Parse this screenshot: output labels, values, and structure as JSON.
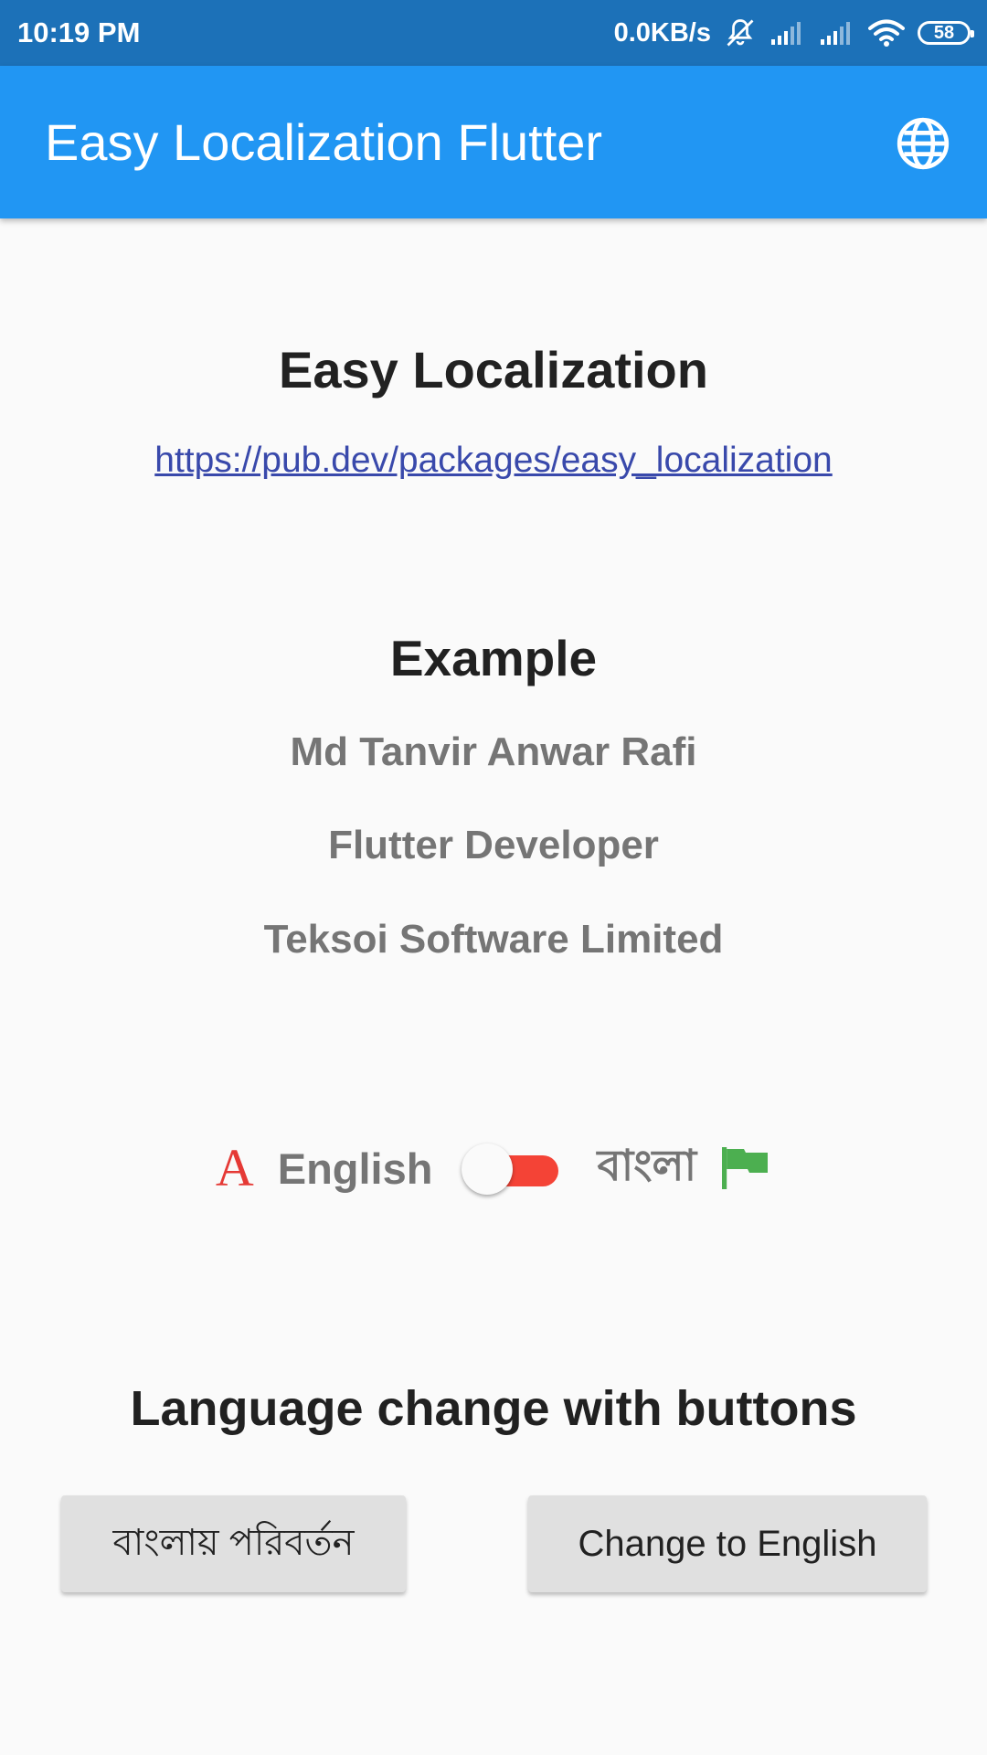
{
  "status_bar": {
    "time": "10:19 PM",
    "net_speed": "0.0KB/s",
    "battery_level": "58",
    "icons": [
      "muted-bell-icon",
      "signal-icon",
      "signal-icon",
      "wifi-icon",
      "battery-icon"
    ]
  },
  "app_bar": {
    "title": "Easy Localization Flutter",
    "action_icon": "globe-icon"
  },
  "main": {
    "package_title": "Easy Localization",
    "package_link": "https://pub.dev/packages/easy_localization",
    "example_title": "Example",
    "name": "Md Tanvir Anwar Rafi",
    "role": "Flutter Developer",
    "company": "Teksoi Software Limited"
  },
  "language_toggle": {
    "left_label": "English",
    "left_icon": "letter-a-icon",
    "right_label": "বাংলা",
    "right_icon": "flag-icon",
    "state": "bangla",
    "active_color": "#f44336"
  },
  "buttons_section": {
    "title": "Language change with buttons",
    "bangla_button": "বাংলায় পরিবর্তন",
    "english_button": "Change to English"
  },
  "colors": {
    "primary": "#2196f3",
    "status_bar": "#1c71b8",
    "link": "#3949ab",
    "flag": "#4caf50",
    "letter_icon": "#e53935"
  }
}
